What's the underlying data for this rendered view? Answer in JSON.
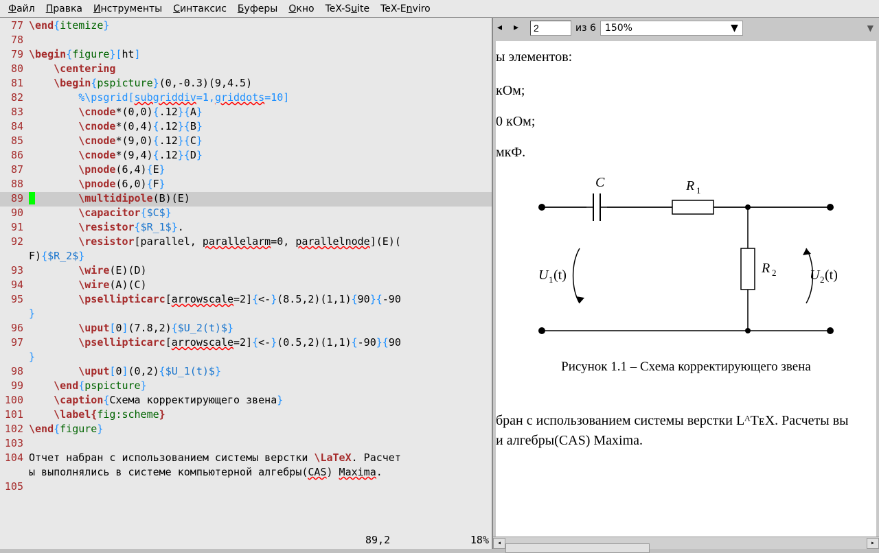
{
  "menu": {
    "file": "Файл",
    "edit": "Правка",
    "tools": "Инструменты",
    "syntax": "Синтаксис",
    "buffers": "Буферы",
    "window": "Окно",
    "texsuite": "TeX-Suite",
    "texenv": "TeX-Environments"
  },
  "editor": {
    "lines": [
      {
        "n": "77",
        "kind": "end",
        "env": "itemize"
      },
      {
        "n": "78",
        "kind": "blank"
      },
      {
        "n": "79",
        "kind": "begin",
        "env": "figure",
        "opt": "ht"
      },
      {
        "n": "80",
        "kind": "cmd",
        "indent": 4,
        "cmd": "\\centering"
      },
      {
        "n": "81",
        "kind": "beginargs",
        "indent": 4,
        "env": "pspicture",
        "args": "(0,-0.3)(9,4.5)"
      },
      {
        "n": "82",
        "kind": "comment",
        "indent": 8,
        "text": "%\\psgrid[subgriddiv=1,griddots=10]"
      },
      {
        "n": "83",
        "kind": "cnode",
        "indent": 8,
        "args": "*(0,0)",
        "a1": ".12",
        "a2": "A"
      },
      {
        "n": "84",
        "kind": "cnode",
        "indent": 8,
        "args": "*(0,4)",
        "a1": ".12",
        "a2": "B"
      },
      {
        "n": "85",
        "kind": "cnode",
        "indent": 8,
        "args": "*(9,0)",
        "a1": ".12",
        "a2": "C"
      },
      {
        "n": "86",
        "kind": "cnode",
        "indent": 8,
        "args": "*(9,4)",
        "a1": ".12",
        "a2": "D"
      },
      {
        "n": "87",
        "kind": "pnode",
        "indent": 8,
        "args": "(6,4)",
        "a1": "E"
      },
      {
        "n": "88",
        "kind": "pnode",
        "indent": 8,
        "args": "(6,0)",
        "a1": "F"
      },
      {
        "n": "89",
        "kind": "multi",
        "indent": 8,
        "args": "(B)(E)",
        "current": true
      },
      {
        "n": "90",
        "kind": "cmdbr",
        "indent": 8,
        "cmd": "\\capacitor",
        "brace": "$C$"
      },
      {
        "n": "91",
        "kind": "resistor1",
        "indent": 8
      },
      {
        "n": "92",
        "kind": "resistor2",
        "indent": 8
      },
      {
        "n": "93",
        "kind": "wire",
        "indent": 8,
        "args": "(E)(D)"
      },
      {
        "n": "94",
        "kind": "wire",
        "indent": 8,
        "args": "(A)(C)"
      },
      {
        "n": "95",
        "kind": "arc1",
        "indent": 8
      },
      {
        "n": "96",
        "kind": "uput",
        "indent": 8,
        "pos": "0",
        "coord": "(7.8,2)",
        "brace": "$U_2(t)$"
      },
      {
        "n": "97",
        "kind": "arc2",
        "indent": 8
      },
      {
        "n": "98",
        "kind": "uput",
        "indent": 8,
        "pos": "0",
        "coord": "(0,2)",
        "brace": "$U_1(t)$"
      },
      {
        "n": "99",
        "kind": "end",
        "indent": 4,
        "env": "pspicture"
      },
      {
        "n": "100",
        "kind": "caption",
        "indent": 4,
        "text": "Схема корректирующего звена"
      },
      {
        "n": "101",
        "kind": "label",
        "indent": 4,
        "arg": "fig:scheme"
      },
      {
        "n": "102",
        "kind": "end",
        "env": "figure"
      },
      {
        "n": "103",
        "kind": "blank"
      },
      {
        "n": "104",
        "kind": "prose"
      },
      {
        "n": "105",
        "kind": "blank"
      }
    ],
    "prose1": "Отчет набран с использованием системы верстки ",
    "prose1b": "\\LaTeX",
    "prose1c": ". Расчеты выполнялись в системе компьютерной алгебры(",
    "prose_cas": "CAS",
    "prose1d": ") ",
    "prose_max": "Maxima",
    "prose1e": ".",
    "resistor1_label": "$R_1$",
    "resistor2_pre": "[parallel, ",
    "resistor2_err1": "parallelarm",
    "resistor2_mid": "=0, ",
    "resistor2_err2": "parallelnode",
    "resistor2_post": "](E)(F)",
    "resistor2_label": "$R_2$",
    "arc1_pre": "[",
    "arc1_err": "arrowscale",
    "arc1_post": "=2]{<-}(8.5,2)(1,1){90}{-90}",
    "arc2_pre": "[",
    "arc2_err": "arrowscale",
    "arc2_post": "=2]{<-}(0.5,2)(1,1){-90}{90}",
    "comment_subgrid": "subgriddiv",
    "comment_griddots": "griddots"
  },
  "status": {
    "pos": "89,2",
    "pct": "18%"
  },
  "preview": {
    "page_current": "2",
    "page_total": "из 6",
    "zoom": "150%",
    "body_lines": {
      "l1": "ы элементов:",
      "l2": " кОм;",
      "l3": "0 кОм;",
      "l4": "мкФ."
    },
    "labels": {
      "C": "C",
      "R1": "R₁",
      "R2": "R₂",
      "U1": "U₁(t)",
      "U2": "U₂(t)"
    },
    "caption": "Рисунок 1.1 – Схема корректирующего звена",
    "para1": "бран с использованием системы верстки LᴬTᴇX. Расчеты вы",
    "para2": "и алгебры(CAS) Maxima."
  }
}
